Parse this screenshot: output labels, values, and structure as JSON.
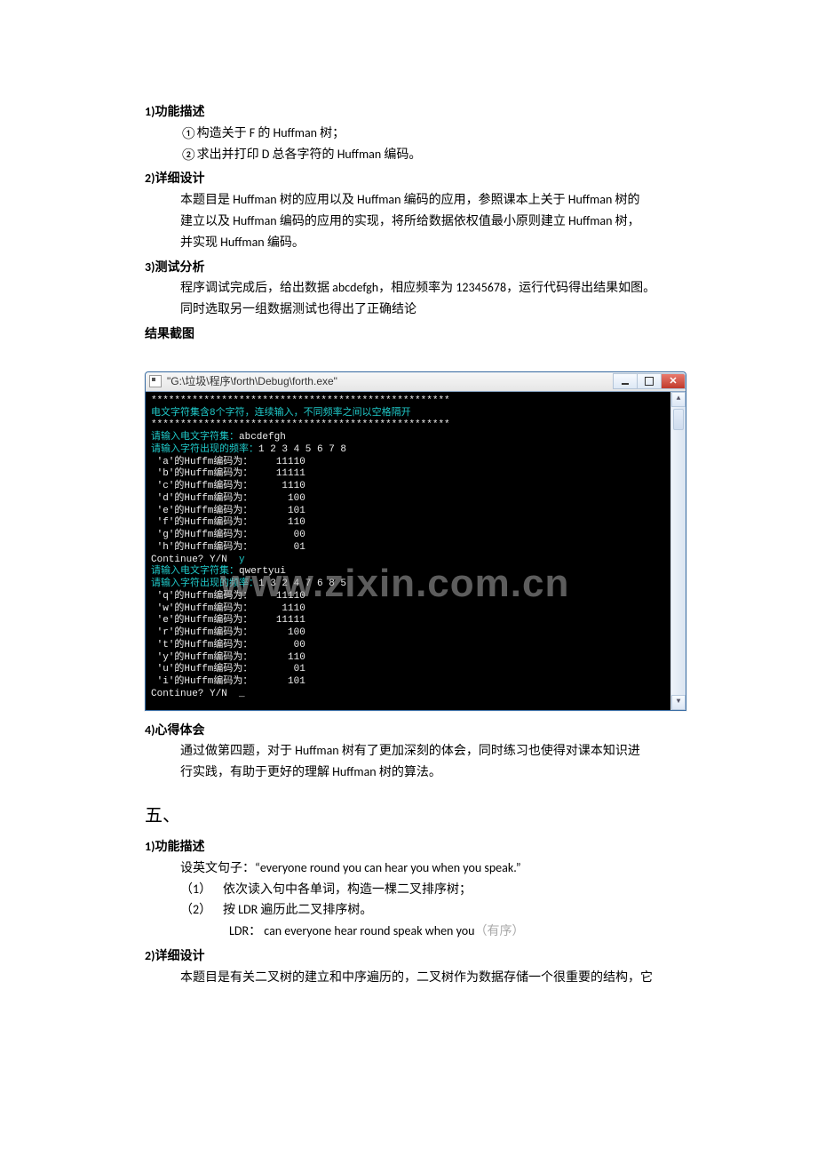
{
  "s1": {
    "head": "1)功能描述",
    "l1": "①构造关于 F 的 Huffman 树；",
    "l2": "②求出并打印 D 总各字符的 Huffman 编码。"
  },
  "s2": {
    "head": "2)详细设计",
    "l1": "本题目是 Huffman 树的应用以及 Huffman 编码的应用，参照课本上关于 Huffman 树的",
    "l2": "建立以及 Huffman 编码的应用的实现，将所给数据依权值最小原则建立 Huffman 树，",
    "l3": "并实现 Huffman 编码。"
  },
  "s3": {
    "head": "3)测试分析",
    "l1": "程序调试完成后，给出数据 abcdefgh，相应频率为 12345678，运行代码得出结果如图。",
    "l2": "同时选取另一组数据测试也得出了正确结论"
  },
  "s4": {
    "head": "结果截图"
  },
  "console": {
    "title": "\"G:\\垃圾\\程序\\forth\\Debug\\forth.exe\"",
    "scroll_up": "▲",
    "scroll_down": "▼",
    "stars1": "***************************************************",
    "banner": "电文字符集含8个字符，连续输入，不同频率之间以空格隔开",
    "stars2": "***************************************************",
    "p1": "请输入电文字符集：",
    "in1": "abcdefgh",
    "p2": "请输入字符出现的频率：",
    "in2": "1 2 3 4 5 6 7 8",
    "r_a": " 'a'的Huffm编码为：    11110",
    "r_b": " 'b'的Huffm编码为：    11111",
    "r_c": " 'c'的Huffm编码为：     1110",
    "r_d": " 'd'的Huffm编码为：      100",
    "r_e": " 'e'的Huffm编码为：      101",
    "r_f": " 'f'的Huffm编码为：      110",
    "r_g": " 'g'的Huffm编码为：       00",
    "r_h": " 'h'的Huffm编码为：       01",
    "cont1": "Continue? Y/N  ",
    "contans1": "y",
    "p3": "请输入电文字符集：",
    "in3": "qwertyui",
    "p4": "请输入字符出现的频率：",
    "in4": "1 3 2 4 7 6 8 5",
    "r_q": " 'q'的Huffm编码为：    11110",
    "r_w": " 'w'的Huffm编码为：     1110",
    "r_e2": " 'e'的Huffm编码为：    11111",
    "r_r": " 'r'的Huffm编码为：      100",
    "r_t": " 't'的Huffm编码为：       00",
    "r_y": " 'y'的Huffm编码为：      110",
    "r_u": " 'u'的Huffm编码为：       01",
    "r_i": " 'i'的Huffm编码为：      101",
    "cont2": "Continue? Y/N  _"
  },
  "watermark": "www.zixin.com.cn",
  "s5": {
    "head": "4)心得体会",
    "l1": "通过做第四题，对于 Huffman 树有了更加深刻的体会，同时练习也使得对课本知识进",
    "l2": "行实践，有助于更好的理解 Huffman 树的算法。"
  },
  "s6": {
    "head": "五、"
  },
  "s7": {
    "head": "1)功能描述",
    "l1": "设英文句子：“everyone round you can hear you when you speak.”",
    "n1": "（1）",
    "t1": "依次读入句中各单词，构造一棵二叉排序树；",
    "n2": "（2）",
    "t2": "按 LDR 遍历此二叉排序树。",
    "ldr_label": "LDR：",
    "ldr_text": "   can everyone hear round speak when you",
    "ldr_note": "（有序）"
  },
  "s8": {
    "head": "2)详细设计",
    "l1": "本题目是有关二叉树的建立和中序遍历的，二叉树作为数据存储一个很重要的结构，它"
  }
}
